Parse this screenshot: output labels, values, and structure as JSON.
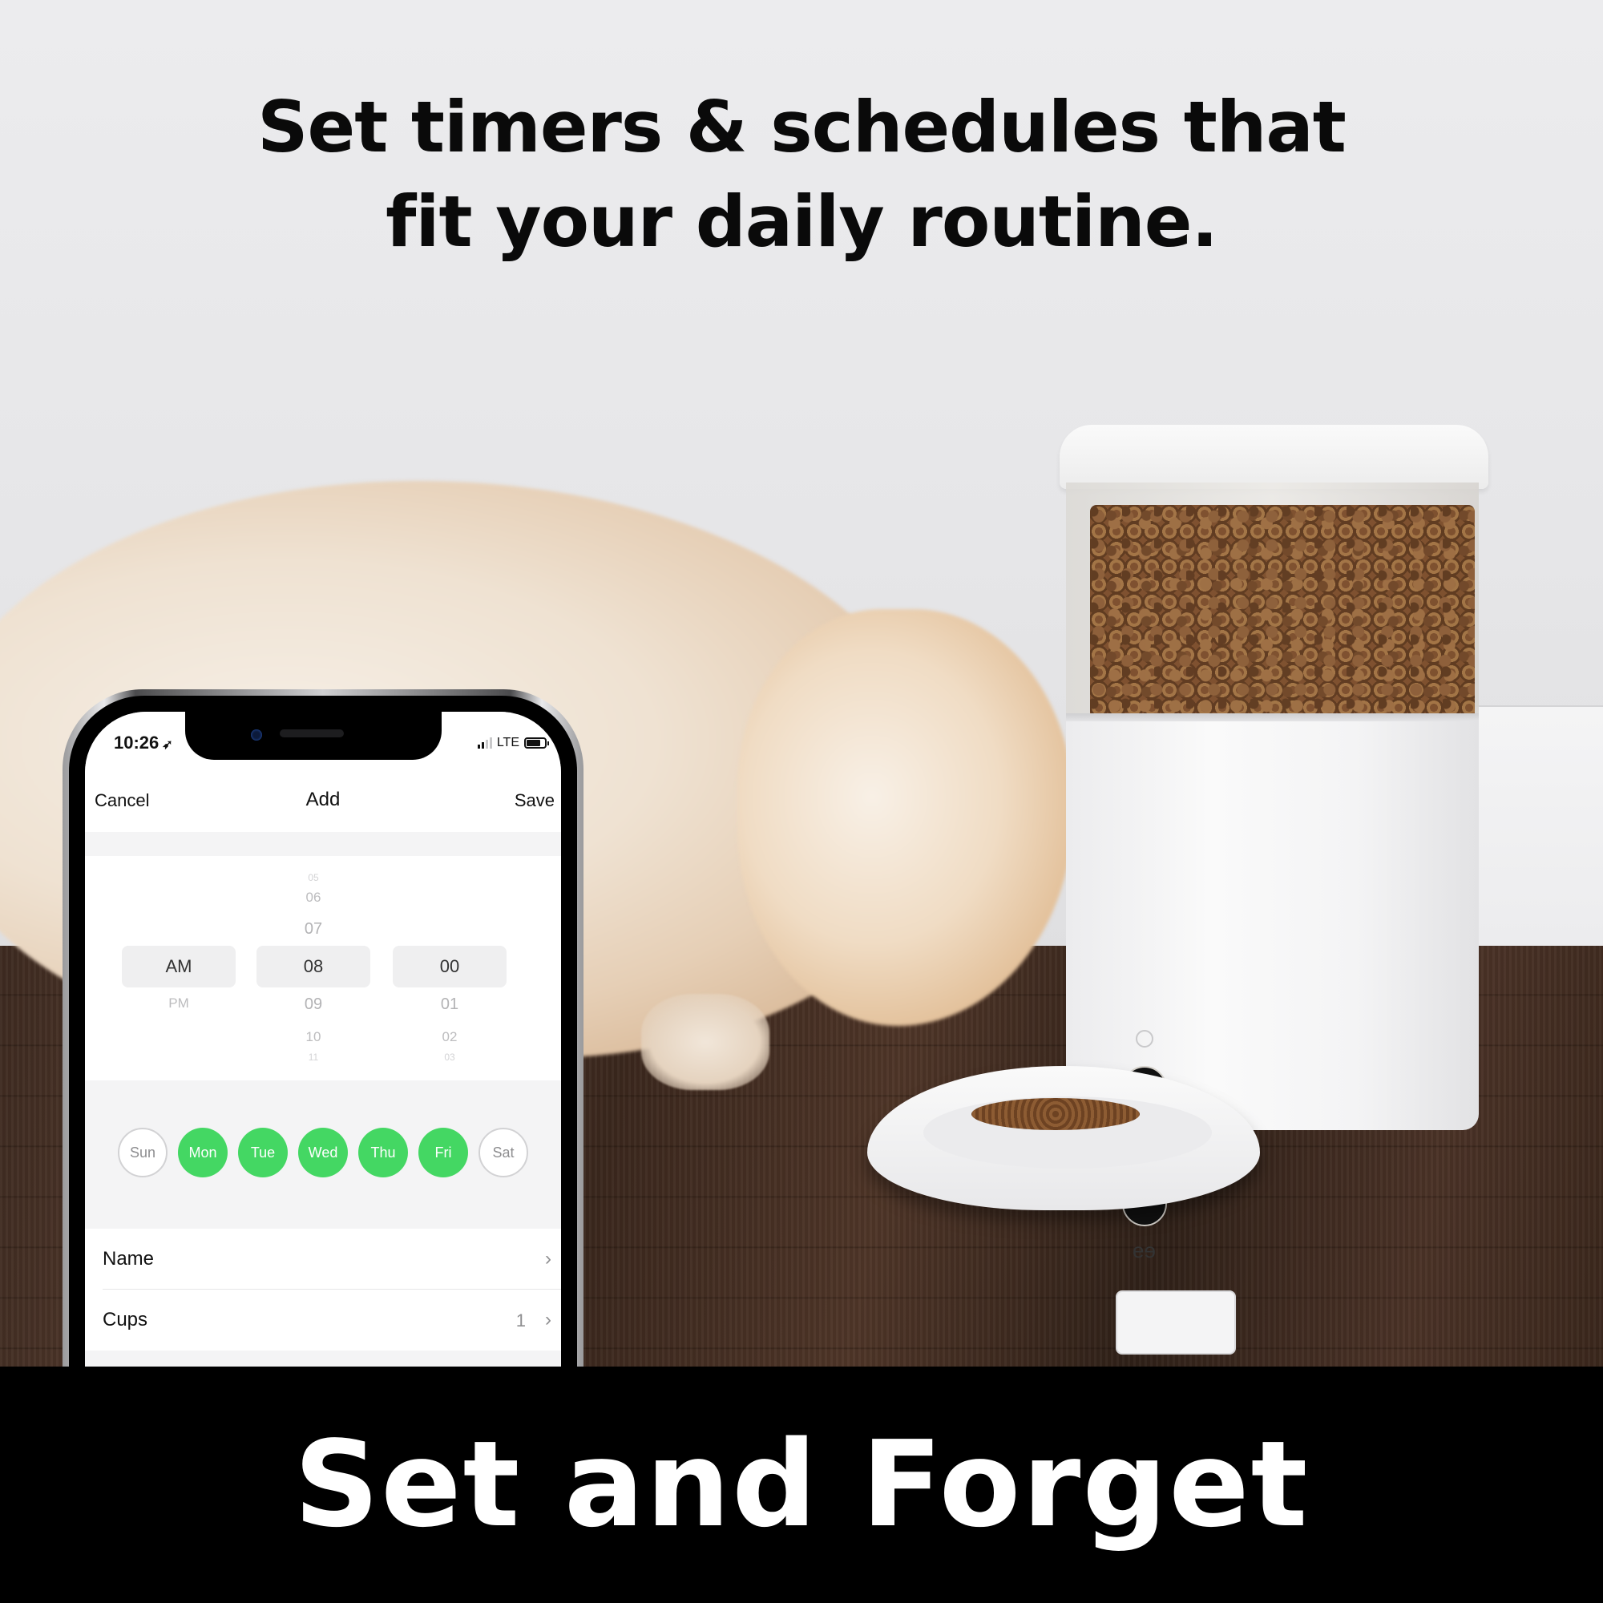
{
  "headline": {
    "line1": "Set timers & schedules that",
    "line2": "fit your daily routine."
  },
  "tagline": "Set and Forget",
  "phone": {
    "status_bar": {
      "time": "10:26",
      "location_icon": "location-arrow-icon",
      "network": "LTE",
      "signal_icon": "cellular-signal-icon",
      "battery_icon": "battery-icon"
    },
    "nav": {
      "cancel_label": "Cancel",
      "title": "Add",
      "save_label": "Save"
    },
    "time_picker": {
      "period": {
        "above": [],
        "selected": "AM",
        "below": [
          "PM"
        ]
      },
      "hour": {
        "above": [
          "05",
          "06",
          "07"
        ],
        "selected": "08",
        "below": [
          "09",
          "10",
          "11"
        ]
      },
      "minute": {
        "above": [],
        "selected": "00",
        "below": [
          "01",
          "02",
          "03"
        ]
      }
    },
    "days": [
      {
        "label": "Sun",
        "selected": false
      },
      {
        "label": "Mon",
        "selected": true
      },
      {
        "label": "Tue",
        "selected": true
      },
      {
        "label": "Wed",
        "selected": true
      },
      {
        "label": "Thu",
        "selected": true
      },
      {
        "label": "Fri",
        "selected": true
      },
      {
        "label": "Sat",
        "selected": false
      }
    ],
    "settings": [
      {
        "label": "Name",
        "value": "",
        "icon": "chevron-right-icon"
      },
      {
        "label": "Cups",
        "value": "1",
        "icon": "chevron-right-icon"
      }
    ],
    "accent_color": "#44d763"
  },
  "feeder": {
    "buttons": [
      "feed-button-icon",
      "voice-record-button-icon",
      "settings-button-icon"
    ],
    "logo_text": "eɘ"
  }
}
